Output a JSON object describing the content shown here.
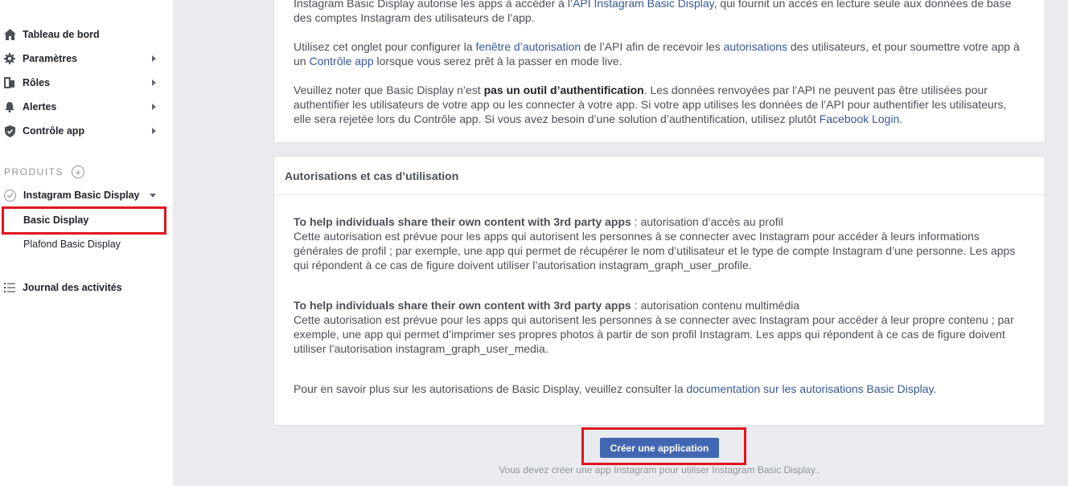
{
  "sidebar": {
    "items": [
      {
        "label": "Tableau de bord",
        "icon": "home-icon"
      },
      {
        "label": "Paramètres",
        "icon": "gear-icon"
      },
      {
        "label": "Rôles",
        "icon": "roles-icon"
      },
      {
        "label": "Alertes",
        "icon": "bell-icon"
      },
      {
        "label": "Contrôle app",
        "icon": "shield-icon"
      }
    ],
    "products_header": "PRODUITS",
    "product": {
      "label": "Instagram Basic Display",
      "sub_items": [
        "Basic Display",
        "Plafond Basic Display"
      ]
    },
    "activity_log": "Journal des activités"
  },
  "intro_card": {
    "p0_start": "Instagram Basic Display autorise les apps à accéder à l’",
    "p0_link": "API Instagram Basic Display",
    "p0_end": ", qui fournit un accès en lecture seule aux données de base des comptes Instagram des utilisateurs de l’app.",
    "p1_a": "Utilisez cet onglet pour configurer la ",
    "p1_link1": "fenêtre d’autorisation",
    "p1_b": " de l’API afin de recevoir les ",
    "p1_link2": "autorisations",
    "p1_c": " des utilisateurs, et pour soumettre votre app à un ",
    "p1_link3": "Contrôle app",
    "p1_d": " lorsque vous serez prêt à la passer en mode live.",
    "p2_a": "Veuillez noter que Basic Display n’est ",
    "p2_bold": "pas un outil d’authentification",
    "p2_b": ". Les données renvoyées par l’API ne peuvent pas être utilisées pour authentifier les utilisateurs de votre app ou les connecter à votre app. Si votre app utilises les données de l’API pour authentifier les utilisateurs, elle sera rejetée lors du Contrôle app. Si vous avez besoin d’une solution d’authentification, utilisez plutôt ",
    "p2_link": "Facebook Login",
    "p2_end": "."
  },
  "permissions_card": {
    "title": "Autorisations et cas d’utilisation",
    "perm1_title": "To help individuals share their own content with 3rd party apps",
    "perm1_name": " : autorisation d’accès au profil",
    "perm1_desc": "Cette autorisation est prévue pour les apps qui autorisent les personnes à se connecter avec Instagram pour accéder à leurs informations générales de profil ; par exemple, une app qui permet de récupérer le nom d’utilisateur et le type de compte Instagram d’une personne. Les apps qui répondent à ce cas de figure doivent utiliser l’autorisation instagram_graph_user_profile.",
    "perm2_title": "To help individuals share their own content with 3rd party apps",
    "perm2_name": " : autorisation contenu multimédia",
    "perm2_desc": "Cette autorisation est prévue pour les apps qui autorisent les personnes à se connecter avec Instagram pour accéder à leur propre contenu ; par exemple, une app qui permet d’imprimer ses propres photos à partir de son profil Instagram. Les apps qui répondent à ce cas de figure doivent utiliser l’autorisation instagram_graph_user_media.",
    "more_a": "Pour en savoir plus sur les autorisations de Basic Display, veuillez consulter la ",
    "more_link": "documentation sur les autorisations Basic Display",
    "more_end": "."
  },
  "create_button": "Créer une application",
  "footnote": "Vous devez créer une app Instagram pour utiliser Instagram Basic Display..",
  "colors": {
    "primary": "#4267b2",
    "link": "#365899",
    "highlight": "#e0141e"
  }
}
